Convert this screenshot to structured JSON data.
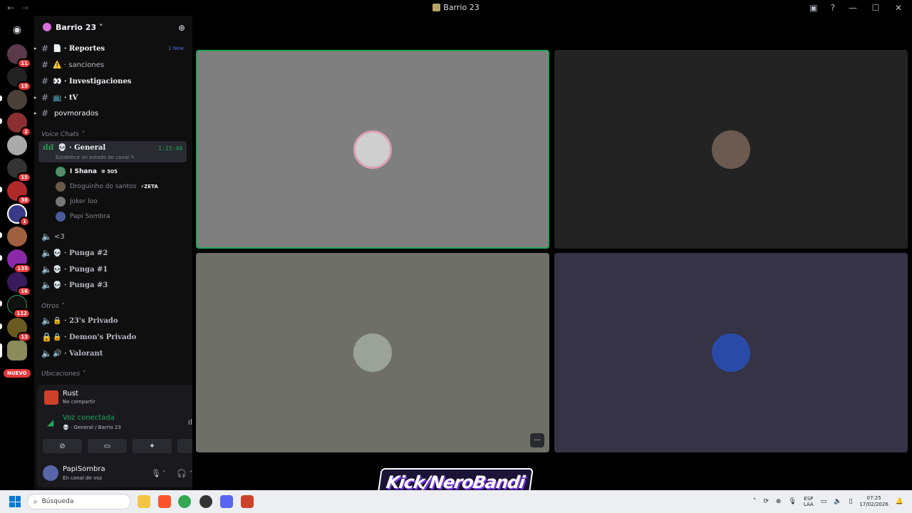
{
  "window": {
    "title": "Barrio 23",
    "back": "←",
    "forward": "→"
  },
  "guilds": {
    "badges": [
      "11",
      "15",
      "2",
      "15",
      "38",
      "1",
      "135",
      "16",
      "112",
      "13"
    ],
    "nuevo": "NUEVO"
  },
  "server": {
    "name": "Barrio 23 ˅",
    "channels": [
      {
        "emoji": "📄",
        "label": "Reportes",
        "suffix": "1 New"
      },
      {
        "emoji": "⚠️",
        "label": "sanciones"
      },
      {
        "emoji": "👀",
        "label": "Investigaciones"
      },
      {
        "emoji": "📺",
        "label": "tV"
      },
      {
        "emoji": "",
        "label": "povmorados"
      }
    ],
    "cat_voice": "Voice Chats ˅",
    "cat_others": "Otros ˅",
    "cat_locations": "Ubicaciones ˅",
    "active_voice": {
      "name": "General",
      "status": "Establece un estado de canal",
      "elapsed": "1:15:49"
    },
    "voice_users": [
      {
        "name": "I Shana",
        "tag": "505"
      },
      {
        "name": "Droguinho do santos",
        "tag": "ZETA"
      },
      {
        "name": "Joker loo",
        "tag": ""
      },
      {
        "name": "Papi Sombra",
        "tag": ""
      }
    ],
    "voice_channels": [
      "<3",
      "Punga #2",
      "Punga #1",
      "Punga #3"
    ],
    "other_channels": [
      "23's Privado",
      "Demon's Privado",
      "Valorant"
    ]
  },
  "activity": {
    "game": "Rust",
    "sub": "No compartir"
  },
  "voice_connection": {
    "status": "Voz conectada",
    "location": "General / Barrio 23"
  },
  "user": {
    "name": "PapiSombra",
    "status": "En canal de voz"
  },
  "stage": {
    "more": "···"
  },
  "watermark": "Kick/NeroBandi",
  "taskbar": {
    "search_placeholder": "Búsqueda",
    "lang_top": "ESP",
    "lang_bottom": "LAA",
    "time": "07:25",
    "date": "17/02/2026"
  },
  "colors": {
    "accent_green": "#23a55a",
    "brand": "#5865f2",
    "badge_red": "#e5383b"
  }
}
